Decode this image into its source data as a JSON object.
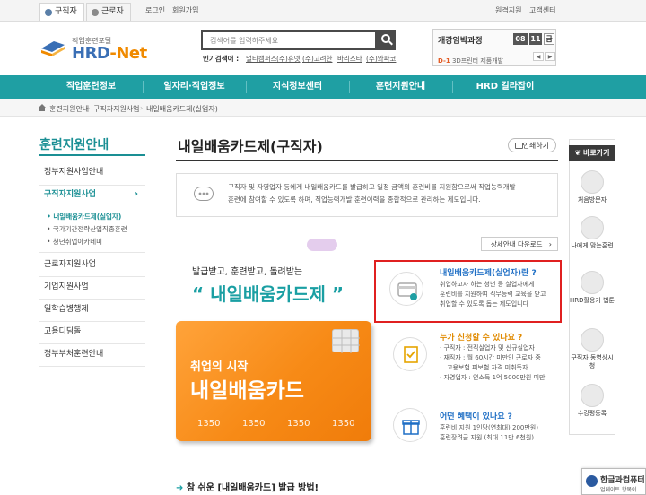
{
  "topbar": {
    "tab_seeker": "구직자",
    "tab_worker": "근로자",
    "login": "로그인",
    "signup": "회원가입",
    "remote": "원격지원",
    "support": "고객센터"
  },
  "logo": {
    "subtitle": "직업훈련포털",
    "main": "HRD",
    "main_suffix": "-Net"
  },
  "search": {
    "placeholder": "검색어를 입력하주세요",
    "popular_label": "인기검색어 :",
    "popular": [
      "멀티캠퍼스",
      "(주)휴넷",
      "(주)고려한",
      "바리스타",
      "(주)와파코"
    ]
  },
  "course": {
    "title": "개강임박과정",
    "date_month": "08",
    "date_day": "11",
    "date_weekday": "금",
    "item_prefix": "D-1",
    "item_text": "3D프린터 제품개발"
  },
  "nav": {
    "items": [
      "직업훈련정보",
      "일자리·직업정보",
      "지식정보센터",
      "훈련지원안내",
      "HRD 길라잡이"
    ]
  },
  "breadcrumb": [
    "훈련지원안내",
    "구직자지원사업",
    "내일배움카드제(실업자)"
  ],
  "sidebar": {
    "title": "훈련지원안내",
    "items": [
      "정부지원사업안내",
      "구직자지원사업",
      "근로자지원사업",
      "기업지원사업",
      "일학습병행제",
      "고용디딤돌",
      "정부부처훈련안내"
    ],
    "subitems": [
      "• 내일배움카드제(실업자)",
      "• 국가기간전략산업직종훈련",
      "• 청년취업아카데미"
    ]
  },
  "main": {
    "title": "내일배움카드제(구직자)",
    "print": "인쇄하기",
    "desc_line1": "구직자 및 자영업자 등에게 내일배움카드를 발급하고 일정 금액의 훈련비를 지원함으로써 직업능력개발",
    "desc_line2": "훈련에 참여할 수 있도록 하며, 직업능력개발 훈련이력을 종합적으로 관리하는 제도입니다.",
    "download": "상세안내 다운로드",
    "hero_sub": "발급받고, 훈련받고, 돌려받는",
    "hero_main": "“ 내일배움카드제 ”",
    "card_line1": "취업의 시작",
    "card_line2": "내일배움카드",
    "card_numbers": [
      "1350",
      "1350",
      "1350",
      "1350"
    ],
    "steps_prefix": "➜",
    "steps": "참 쉬운 [내일배움카드] 발급 방법!"
  },
  "info": {
    "q1_title": "내일배움카드제(실업자)란 ?",
    "q1_text": [
      "취업하고자 하는 청년 등 실업자에게",
      "훈련비를 지원하여 직무능력 교육을 받고",
      "취업할 수 있도록 돕는 제도입니다"
    ],
    "q2_title": "누가 신청할 수 있나요 ?",
    "q2_items": [
      "· 구직자 : 전직실업자 및 신규실업자",
      "· 재직자 : 월 60시간 미만인 근로자 중",
      "  고용보험 피보험 자격 미취득자",
      "· 자영업자 : 연소득 1억 5000만원 미만"
    ],
    "q3_title": "어떤 혜택이 있나요 ?",
    "q3_items": [
      "훈련비 지원 1인당(연최대) 200만원)",
      "훈련장려금 지원 (최대 11만 6천원)"
    ]
  },
  "quick": {
    "header": "바로가기",
    "items": [
      "처음방문자",
      "나에게 맞는훈련",
      "HRD활용기 법툰",
      "구직자 동영상시청",
      "수강평등록"
    ]
  },
  "popup": {
    "title": "한글과컴퓨터",
    "sub": "업데이트 항목이"
  },
  "colors": {
    "teal": "#1f9fa3",
    "orange": "#f78a16",
    "highlight": "#e02020"
  }
}
